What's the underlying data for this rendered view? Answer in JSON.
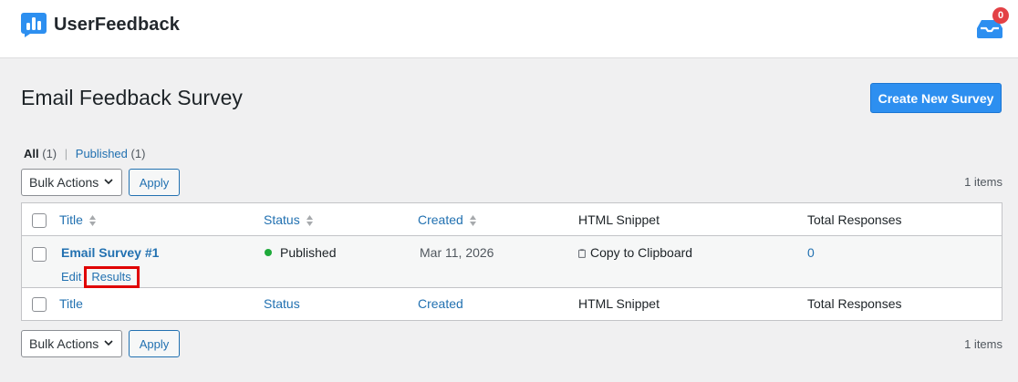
{
  "app": {
    "logo_text": "UserFeedback",
    "notifications_count": "0"
  },
  "page": {
    "title": "Email Feedback Survey",
    "create_button": "Create New Survey"
  },
  "filters": {
    "all_label": "All",
    "all_count": "(1)",
    "separator": "|",
    "published_label": "Published",
    "published_count": "(1)"
  },
  "bulk_top": {
    "label": "Bulk Actions",
    "apply": "Apply",
    "count": "1 items"
  },
  "bulk_bottom": {
    "label": "Bulk Actions",
    "apply": "Apply",
    "count": "1 items"
  },
  "table": {
    "columns": [
      "Title",
      "Status",
      "Created",
      "HTML Snippet",
      "Total Responses"
    ],
    "rows": [
      {
        "title": "Email Survey #1",
        "actions": [
          "Edit",
          "Results"
        ],
        "status": "Published",
        "created": "Mar 11, 2026",
        "snippet": "Copy to Clipboard",
        "responses": "0"
      }
    ]
  },
  "colors": {
    "accent": "#2d8ff0",
    "link": "#2271b1",
    "published": "#1faa3b",
    "badge": "#e34145",
    "highlight": "#e00000"
  }
}
